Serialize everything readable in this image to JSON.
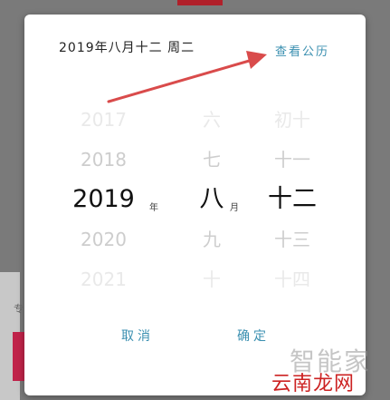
{
  "header": {
    "date_text": "2019年八月十二 周二",
    "action_label": "查看公历"
  },
  "picker": {
    "year": {
      "items": [
        "2017",
        "2018",
        "2019",
        "2020",
        "2021"
      ],
      "unit": "年"
    },
    "month": {
      "items": [
        "六",
        "七",
        "八",
        "九",
        "十"
      ],
      "unit": "月"
    },
    "day": {
      "items": [
        "初十",
        "十一",
        "十二",
        "十三",
        "十四"
      ]
    }
  },
  "buttons": {
    "cancel": "取消",
    "confirm": "确定"
  },
  "background": {
    "left_text": "专"
  },
  "watermark": {
    "brand_cn": "智能家",
    "site_cn": "云南龙网"
  },
  "colors": {
    "action": "#3a8fb0",
    "arrow": "#d94b4b",
    "overlay": "#7a7a7a"
  }
}
